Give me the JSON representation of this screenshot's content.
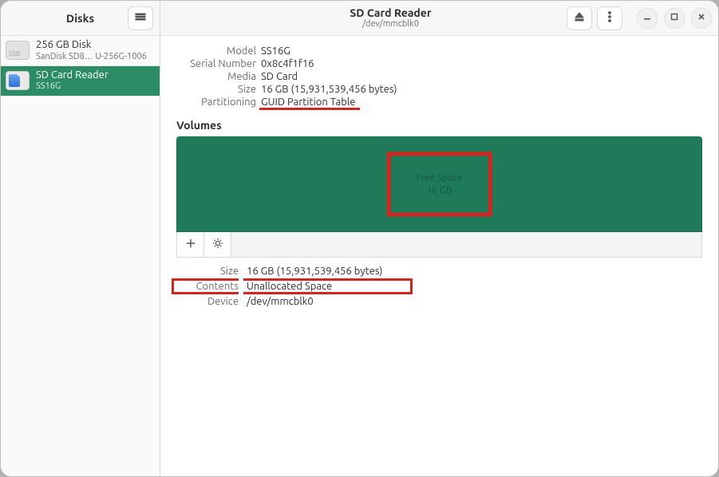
{
  "sidebar": {
    "title": "Disks",
    "devices": [
      {
        "title": "256 GB Disk",
        "subtitle": "SanDisk SD8…  U-256G-1006"
      },
      {
        "title": "SD Card Reader",
        "subtitle": "SS16G"
      }
    ]
  },
  "header": {
    "title": "SD Card Reader",
    "subtitle": "/dev/mmcblk0"
  },
  "device_props": {
    "model_label": "Model",
    "model_value": "SS16G",
    "serial_label": "Serial Number",
    "serial_value": "0x8c4f1f16",
    "media_label": "Media",
    "media_value": "SD Card",
    "size_label": "Size",
    "size_value": "16 GB (15,931,539,456 bytes)",
    "partitioning_label": "Partitioning",
    "partitioning_value": "GUID Partition Table"
  },
  "volumes": {
    "heading": "Volumes",
    "free_label": "Free Space",
    "free_size": "16 GB"
  },
  "volume_props": {
    "size_label": "Size",
    "size_value": "16 GB (15,931,539,456 bytes)",
    "contents_label": "Contents",
    "contents_value": "Unallocated Space",
    "device_label": "Device",
    "device_value": "/dev/mmcblk0"
  },
  "colors": {
    "selection": "#2c8c66",
    "volume_block": "#1f7a5a",
    "highlight": "#d1261f"
  }
}
